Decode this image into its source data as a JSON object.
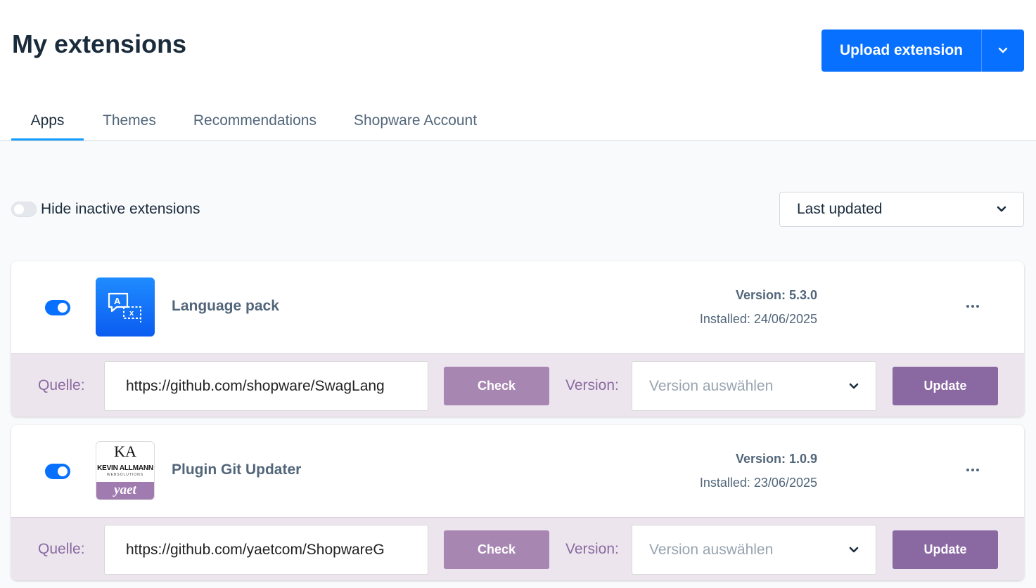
{
  "header": {
    "title": "My extensions",
    "upload_label": "Upload extension"
  },
  "tabs": [
    {
      "label": "Apps",
      "active": true
    },
    {
      "label": "Themes",
      "active": false
    },
    {
      "label": "Recommendations",
      "active": false
    },
    {
      "label": "Shopware Account",
      "active": false
    }
  ],
  "filters": {
    "hide_inactive_label": "Hide inactive extensions",
    "hide_inactive_on": false,
    "sort_value": "Last updated"
  },
  "extensions": [
    {
      "name": "Language pack",
      "active": true,
      "icon": "translate-icon",
      "version": "Version: 5.3.0",
      "installed": "Installed: 24/06/2025",
      "source_label": "Quelle:",
      "source_url": "https://github.com/shopware/SwagLang",
      "check_label": "Check",
      "version_label": "Version:",
      "version_placeholder": "Version auswählen",
      "update_label": "Update"
    },
    {
      "name": "Plugin Git Updater",
      "active": true,
      "icon": "kevin-allmann-yaet-logo",
      "logo_monogram": "KA",
      "logo_name": "KEVIN ALLMANN",
      "logo_sub": "WEBSOLUTIONS",
      "logo_brand": "yaet",
      "version": "Version: 1.0.9",
      "installed": "Installed: 23/06/2025",
      "source_label": "Quelle:",
      "source_url": "https://github.com/yaetcom/ShopwareG",
      "check_label": "Check",
      "version_label": "Version:",
      "version_placeholder": "Version auswählen",
      "update_label": "Update"
    }
  ],
  "colors": {
    "primary": "#0870ff",
    "tab_active_underline": "#189eff",
    "check_button": "#a886b2",
    "update_button": "#8a68a2",
    "update_row_bg": "#ede5ee"
  }
}
